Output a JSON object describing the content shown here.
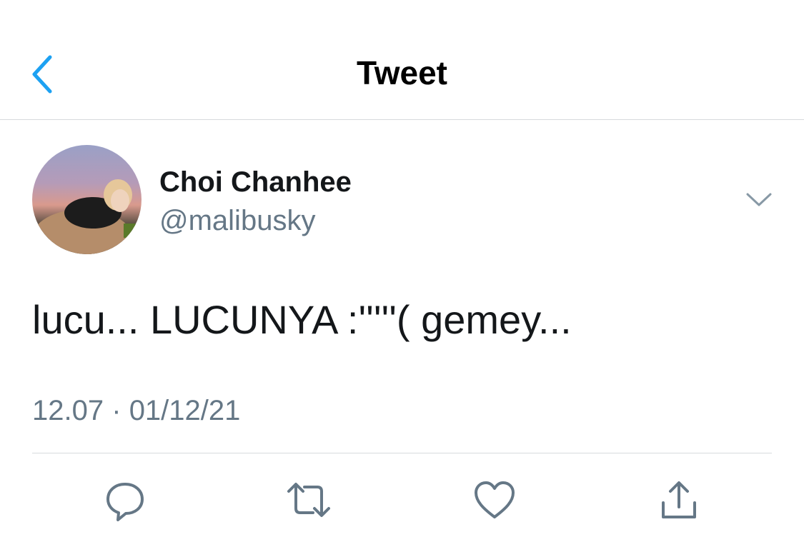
{
  "header": {
    "title": "Tweet",
    "back_icon": "chevron-left-icon",
    "accent_color": "#1da1f2"
  },
  "author": {
    "name": "Choi Chanhee",
    "handle": "@malibusky"
  },
  "tweet": {
    "text": "lucu... LUCUNYA :'''''( gemey...",
    "time": "12.07",
    "separator": "·",
    "date": "01/12/21"
  },
  "actions": [
    {
      "icon": "reply-icon"
    },
    {
      "icon": "retweet-icon"
    },
    {
      "icon": "like-icon"
    },
    {
      "icon": "share-icon"
    }
  ],
  "colors": {
    "text": "#14171a",
    "secondary": "#657786",
    "divider": "#d7dadd"
  }
}
